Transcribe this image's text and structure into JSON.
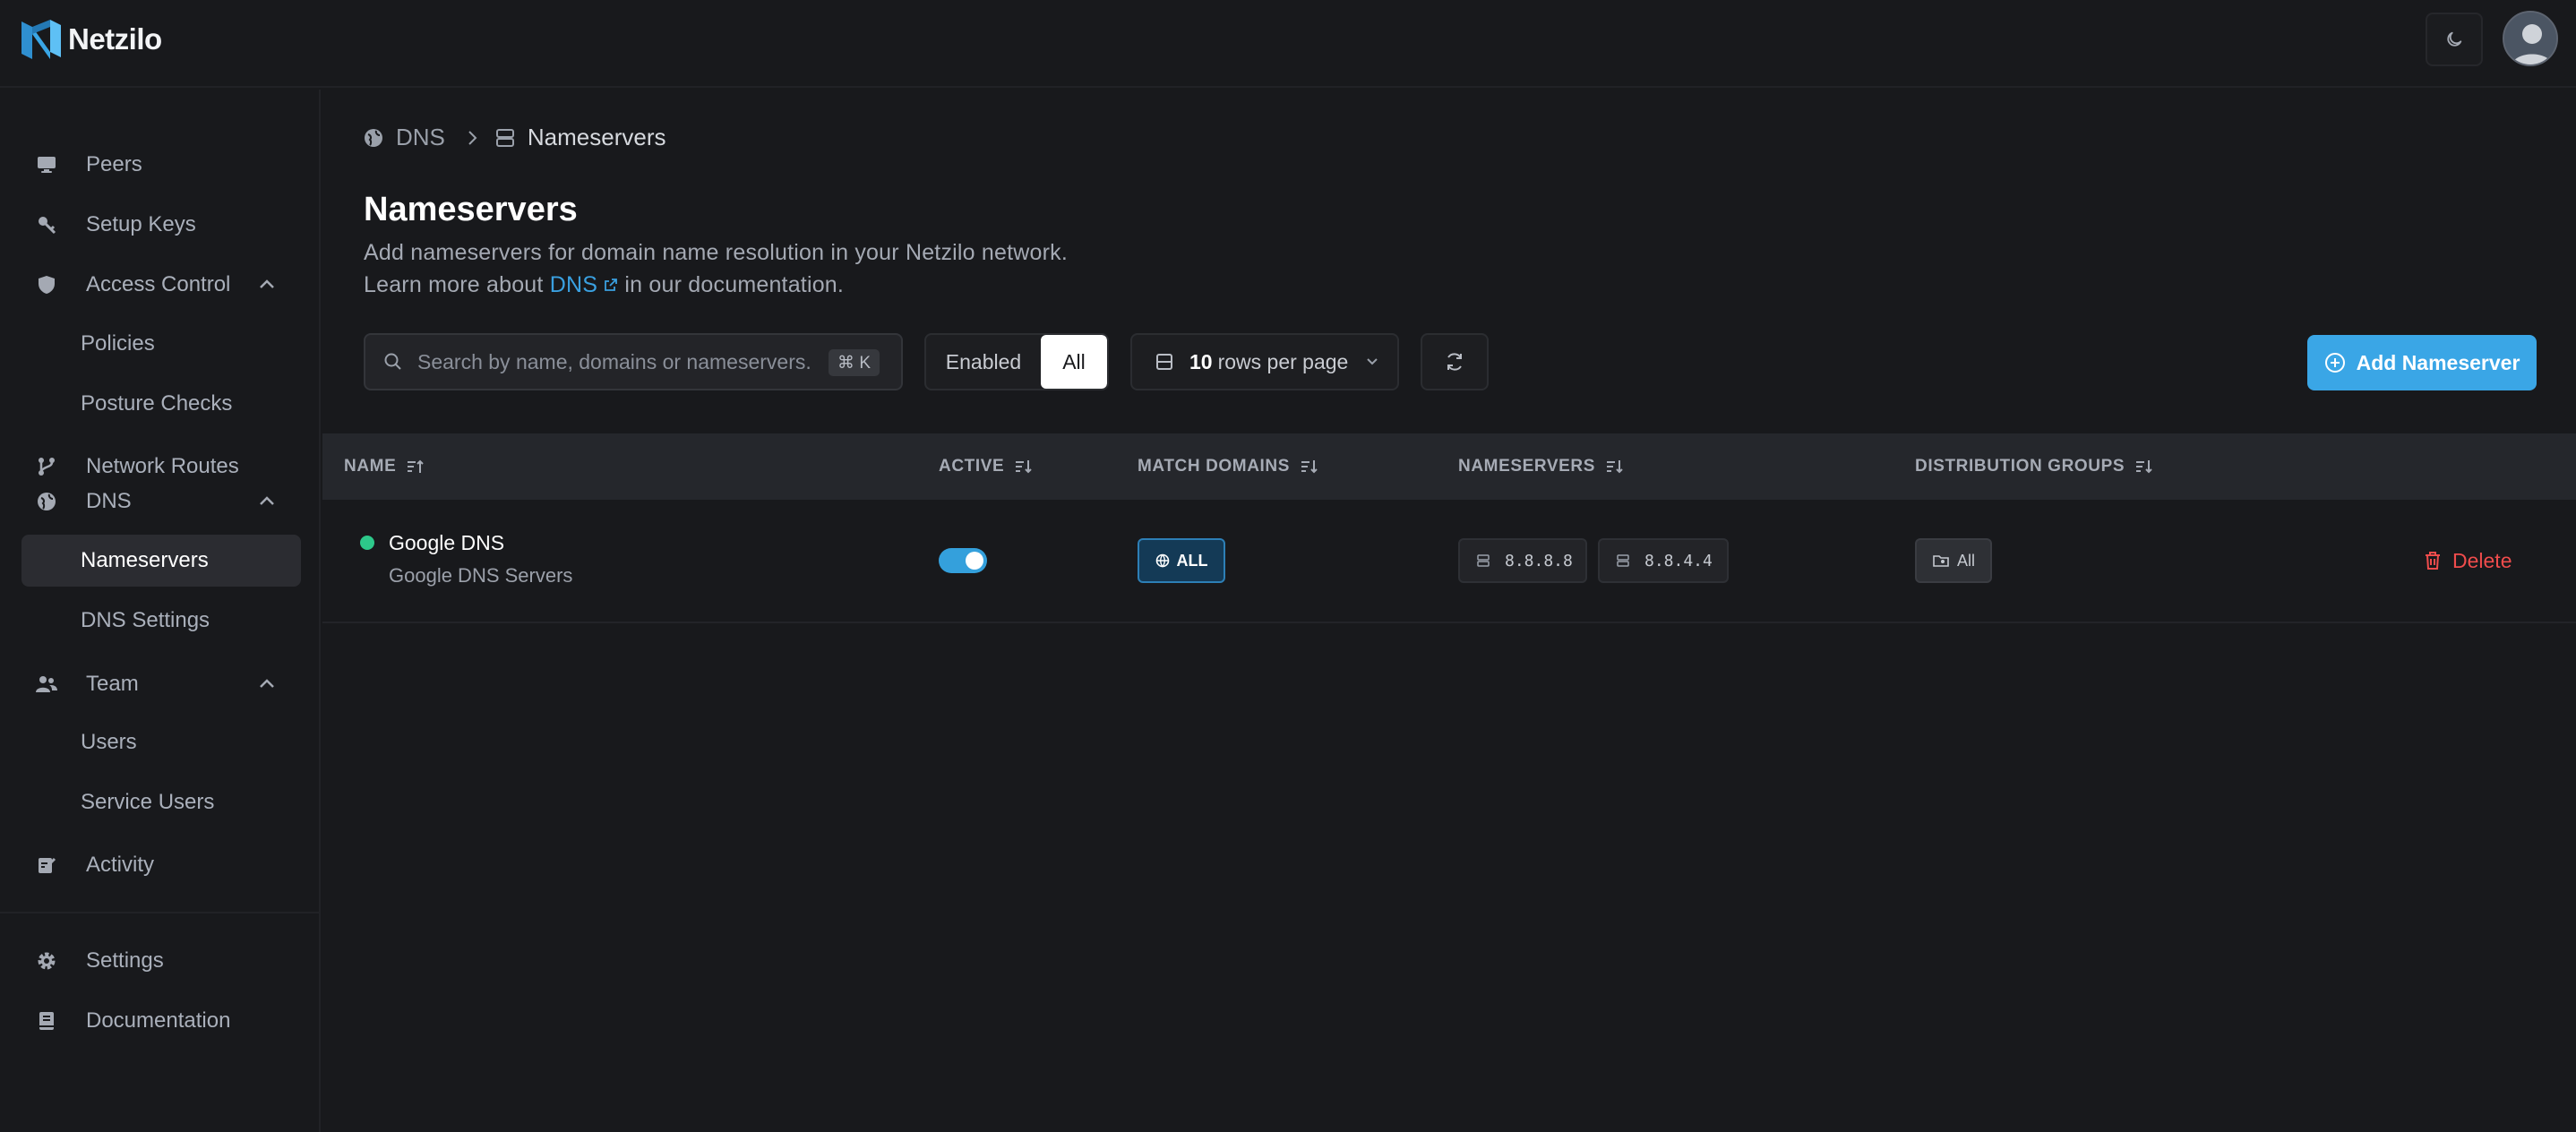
{
  "app": {
    "name": "Netzilo",
    "brand_color": "#3aa6e6"
  },
  "sidebar": {
    "items": [
      {
        "label": "Peers",
        "icon": "monitor-icon"
      },
      {
        "label": "Setup Keys",
        "icon": "key-icon"
      },
      {
        "label": "Access Control",
        "icon": "shield-icon",
        "expanded": true,
        "children": [
          {
            "label": "Policies"
          },
          {
            "label": "Posture Checks"
          }
        ]
      },
      {
        "label": "Network Routes",
        "icon": "route-icon"
      },
      {
        "label": "DNS",
        "icon": "globe-icon",
        "expanded": true,
        "children": [
          {
            "label": "Nameservers",
            "active": true
          },
          {
            "label": "DNS Settings"
          }
        ]
      },
      {
        "label": "Team",
        "icon": "users-icon",
        "expanded": true,
        "children": [
          {
            "label": "Users"
          },
          {
            "label": "Service Users"
          }
        ]
      },
      {
        "label": "Activity",
        "icon": "activity-icon"
      }
    ],
    "bottom": [
      {
        "label": "Settings",
        "icon": "gear-icon"
      },
      {
        "label": "Documentation",
        "icon": "book-icon"
      }
    ]
  },
  "breadcrumb": {
    "parent": "DNS",
    "current": "Nameservers"
  },
  "page": {
    "title": "Nameservers",
    "description": "Add nameservers for domain name resolution in your Netzilo network.",
    "learn_prefix": "Learn more about",
    "learn_link": "DNS",
    "learn_suffix": "in our documentation."
  },
  "toolbar": {
    "search_placeholder": "Search by name, domains or nameservers...",
    "search_shortcut": "⌘ K",
    "filter_options": [
      "Enabled",
      "All"
    ],
    "filter_selected": "All",
    "rows_value": "10",
    "rows_label": "rows per page",
    "add_label": "Add Nameserver"
  },
  "table": {
    "columns": [
      "NAME",
      "ACTIVE",
      "MATCH DOMAINS",
      "NAMESERVERS",
      "DISTRIBUTION GROUPS"
    ],
    "rows": [
      {
        "name": "Google DNS",
        "description": "Google DNS Servers",
        "status_color": "#2dc88a",
        "active": true,
        "match_domains": "ALL",
        "nameservers": [
          "8.8.8.8",
          "8.8.4.4"
        ],
        "groups": [
          "All"
        ],
        "delete_label": "Delete"
      }
    ]
  }
}
